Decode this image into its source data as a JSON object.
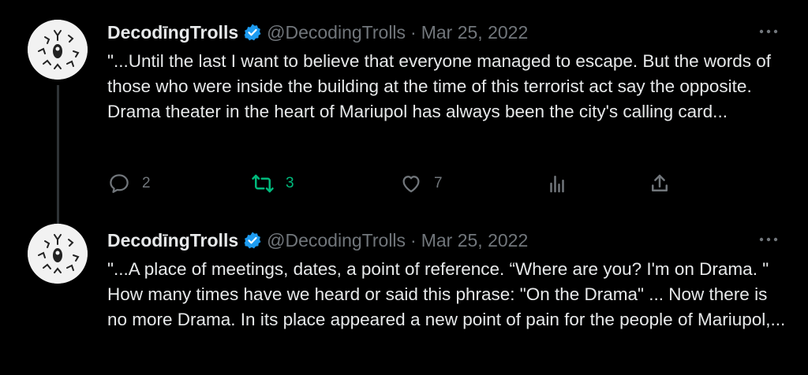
{
  "colors": {
    "background": "#000000",
    "text": "#e7e9ea",
    "muted": "#71767b",
    "verified": "#1d9bf0",
    "retweet_active": "#00ba7c"
  },
  "tweets": [
    {
      "author_name": "DecodīngTrolls",
      "handle": "@DecodingTrolls",
      "separator": "·",
      "date": "Mar 25, 2022",
      "text": "\"...Until the last I want to believe that everyone managed to escape. But the words of those who were inside the building at the time of this terrorist act say the opposite. Drama theater in the heart of Mariupol has always been the city's calling card...",
      "replies": "2",
      "retweets": "3",
      "likes": "7",
      "icons": [
        "reply-icon",
        "retweet-icon",
        "like-icon",
        "views-icon",
        "share-icon"
      ]
    },
    {
      "author_name": "DecodīngTrolls",
      "handle": "@DecodingTrolls",
      "separator": "·",
      "date": "Mar 25, 2022",
      "text": "\"...A place of meetings, dates, a point of reference. “Where are you? I'm on Drama. \" How many times have we heard or said this phrase: \"On the Drama\" ... Now there is no more Drama. In its place appeared a new point of pain for the people of Mariupol,..."
    }
  ]
}
